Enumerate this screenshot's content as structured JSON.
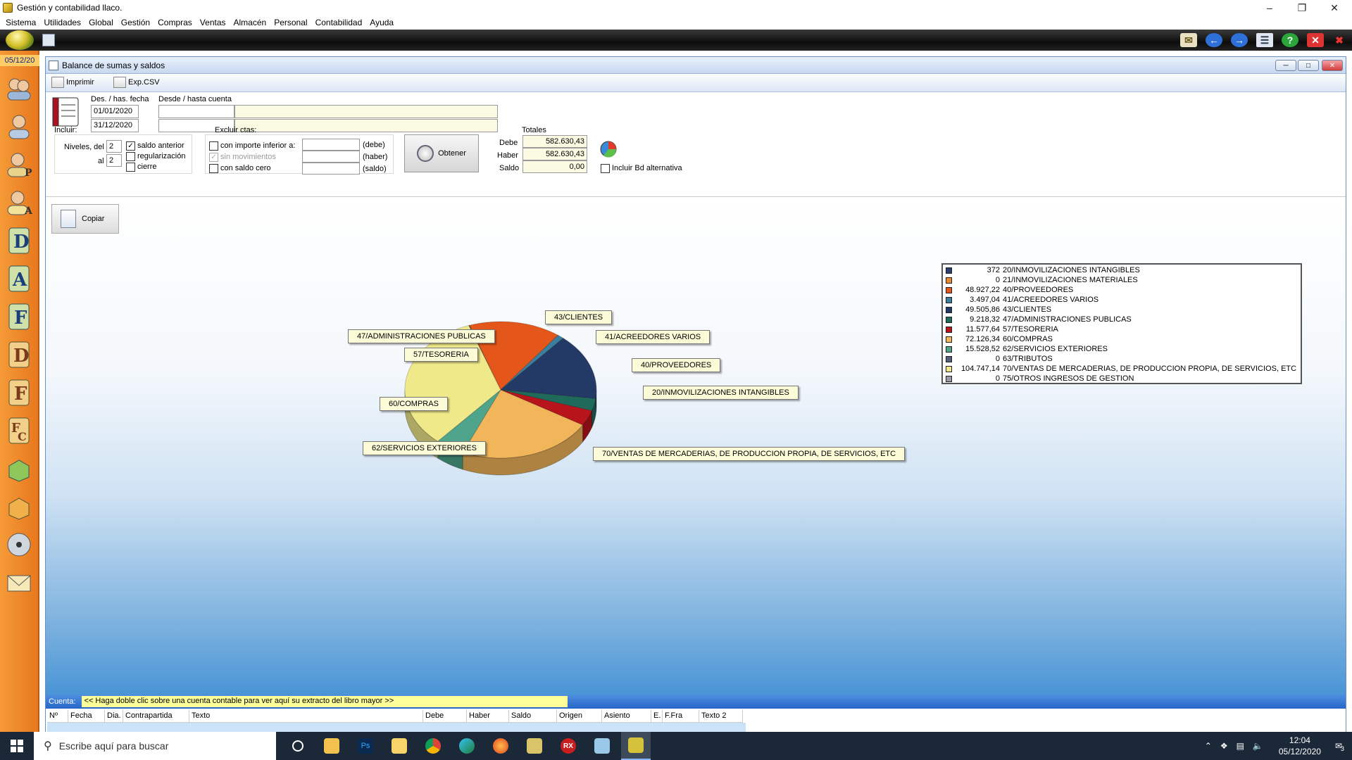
{
  "app": {
    "title": "Gestión y contabilidad llaco.",
    "menu": [
      "Sistema",
      "Utilidades",
      "Global",
      "Gestión",
      "Compras",
      "Ventas",
      "Almacén",
      "Personal",
      "Contabilidad",
      "Ayuda"
    ],
    "date_badge": "05/12/20"
  },
  "child": {
    "title": "Balance de sumas y saldos",
    "toolbar": {
      "print_label": "Imprimir",
      "export_label": "Exp.CSV"
    }
  },
  "form": {
    "date_label": "Des. / has. fecha",
    "date_from": "01/01/2020",
    "date_to": "31/12/2020",
    "account_label": "Desde / hasta cuenta",
    "incluir_label": "Incluir:",
    "niveles_label": "Niveles, del",
    "niveles_from": "2",
    "al_label": "al",
    "niveles_to": "2",
    "saldo_anterior": "saldo anterior",
    "regularizacion": "regularización",
    "cierre": "cierre",
    "excluir_label": "Excluir ctas:",
    "con_importe": "con importe inferior a:",
    "sin_movimientos": "sin movimientos",
    "con_saldo_cero": "con saldo cero",
    "debe_paren": "(debe)",
    "haber_paren": "(haber)",
    "saldo_paren": "(saldo)",
    "obtener_label": "Obtener",
    "totales_label": "Totales",
    "debe_label": "Debe",
    "debe_value": "582.630,43",
    "haber_label": "Haber",
    "haber_value": "582.630,43",
    "saldo_label": "Saldo",
    "saldo_value": "0,00",
    "incluir_bd": "Incluir Bd alternativa",
    "copiar_label": "Copiar"
  },
  "chart_data": {
    "type": "pie",
    "style": "3d",
    "title": "",
    "legend_position": "top-right",
    "slices": [
      {
        "label": "20/INMOVILIZACIONES INTANGIBLES",
        "value": 372,
        "amount_text": "372",
        "color": "#2b3f6e"
      },
      {
        "label": "21/INMOVILIZACIONES MATERIALES",
        "value": 0,
        "amount_text": "0",
        "color": "#e4892e"
      },
      {
        "label": "40/PROVEEDORES",
        "value": 48927.22,
        "amount_text": "48.927,22",
        "color": "#e5561a"
      },
      {
        "label": "41/ACREEDORES VARIOS",
        "value": 3497.04,
        "amount_text": "3.497,04",
        "color": "#3b7f9e"
      },
      {
        "label": "43/CLIENTES",
        "value": 49505.86,
        "amount_text": "49.505,86",
        "color": "#243a66"
      },
      {
        "label": "47/ADMINISTRACIONES PUBLICAS",
        "value": 9218.32,
        "amount_text": "9.218,32",
        "color": "#1f6a5a"
      },
      {
        "label": "57/TESORERIA",
        "value": 11577.64,
        "amount_text": "11.577,64",
        "color": "#b7141c"
      },
      {
        "label": "60/COMPRAS",
        "value": 72126.34,
        "amount_text": "72.126,34",
        "color": "#f1b55a"
      },
      {
        "label": "62/SERVICIOS EXTERIORES",
        "value": 15528.52,
        "amount_text": "15.528,52",
        "color": "#4fa58c"
      },
      {
        "label": "63/TRIBUTOS",
        "value": 0,
        "amount_text": "0",
        "color": "#555f7a"
      },
      {
        "label": "70/VENTAS DE MERCADERIAS, DE PRODUCCION PROPIA, DE SERVICIOS, ETC",
        "value": 104747.14,
        "amount_text": "104.747,14",
        "color": "#efe98a"
      },
      {
        "label": "75/OTROS INGRESOS DE GESTION",
        "value": 0,
        "amount_text": "0",
        "color": "#9a9aa8"
      }
    ]
  },
  "bottom": {
    "cuenta_label": "Cuenta:",
    "cuenta_hint": "<< Haga doble clic sobre una cuenta contable para ver aquí su extracto del libro mayor >>",
    "columns": [
      "Nº",
      "Fecha",
      "Dia.",
      "Contrapartida",
      "Texto",
      "Debe",
      "Haber",
      "Saldo",
      "Origen",
      "Asiento",
      "E.",
      "F.Fra",
      "Texto 2"
    ]
  },
  "taskbar": {
    "search_placeholder": "Escribe aquí para buscar",
    "time": "12:04",
    "date": "05/12/2020",
    "notifications": "3"
  }
}
